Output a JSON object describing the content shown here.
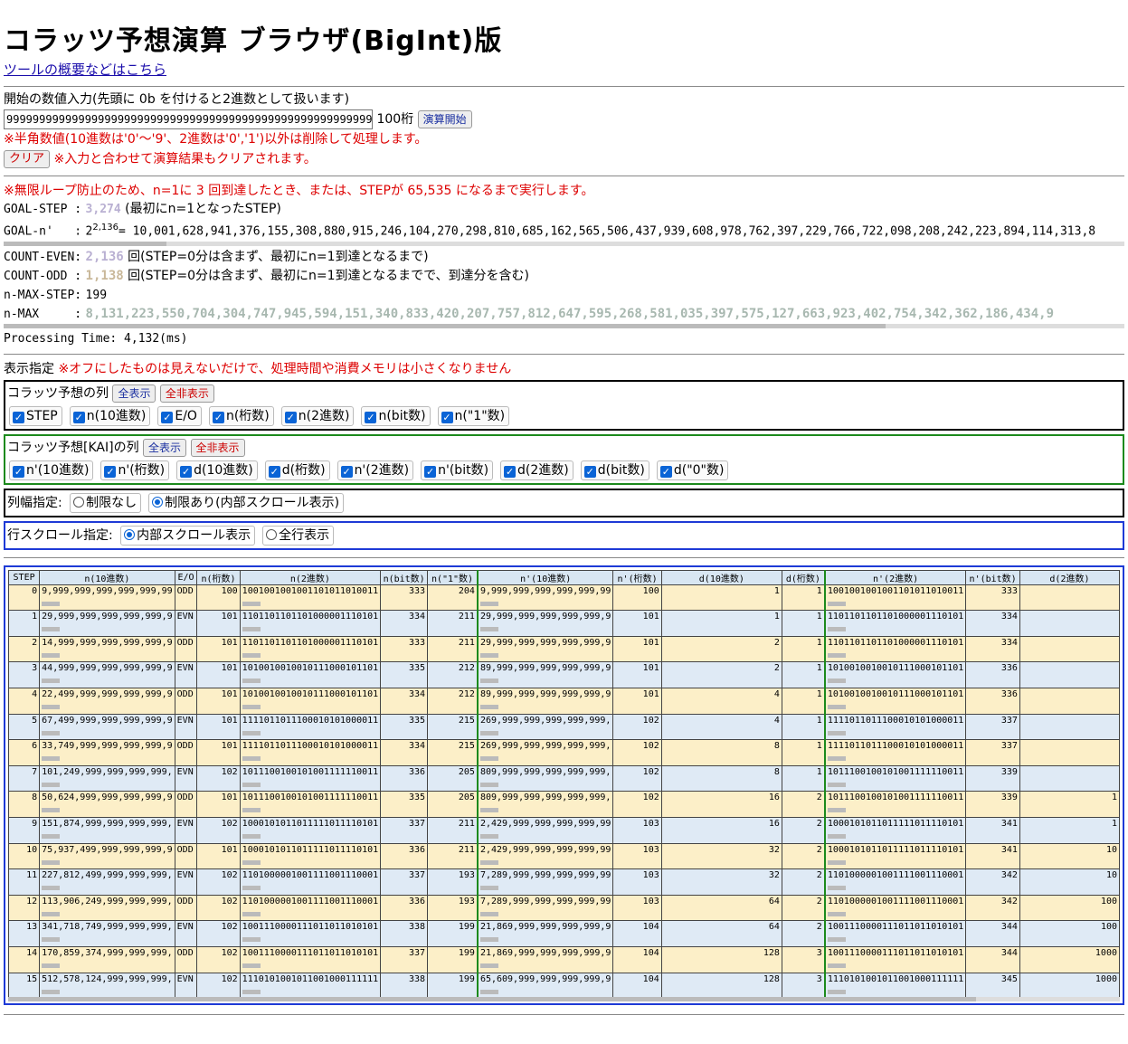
{
  "title": "コラッツ予想演算 ブラウザ(BigInt)版",
  "overview_link": "ツールの概要などはこちら",
  "input": {
    "label": "開始の数値入力(先頭に 0b を付けると2進数として扱います)",
    "value": "9999999999999999999999999999999999999999999999999999999999999999999999999999999999999999999999999999",
    "digits": "100桁",
    "start_button": "演算開始",
    "note": "※半角数値(10進数は'0'～'9'、2進数は'0','1')以外は削除して処理します。",
    "clear_button": "クリア",
    "clear_note": "※入力と合わせて演算結果もクリアされます。"
  },
  "results": {
    "note": "※無限ループ防止のため、n=1に 3 回到達したとき、または、STEPが 65,535 になるまで実行します。",
    "goal_step_label": "GOAL-STEP :",
    "goal_step_value": "3,274",
    "goal_step_note": "(最初にn=1となったSTEP)",
    "goal_n_label": "GOAL-n'   :",
    "goal_n_base": "2",
    "goal_n_exp": "2,136",
    "goal_n_value": "= 10,001,628,941,376,155,308,880,915,246,104,270,298,810,685,162,565,506,437,939,608,978,762,397,229,766,722,098,208,242,223,894,114,313,8",
    "count_even_label": "COUNT-EVEN:",
    "count_even_value": "2,136",
    "count_even_note": "回(STEP=0分は含まず、最初にn=1到達となるまで)",
    "count_odd_label": "COUNT-ODD :",
    "count_odd_value": "1,138",
    "count_odd_note": "回(STEP=0分は含まず、最初にn=1到達となるまでで、到達分を含む)",
    "max_step_label": "n-MAX-STEP:",
    "max_step_value": "199",
    "max_label": "n-MAX     :",
    "max_value": "8,131,223,550,704,304,747,945,594,151,340,833,420,207,757,812,647,595,268,581,035,397,575,127,663,923,402,754,342,362,186,434,9",
    "processing_time": "Processing Time: 4,132(ms)"
  },
  "display": {
    "label": "表示指定",
    "note": "※オフにしたものは見えないだけで、処理時間や消費メモリは小さくなりません",
    "collatz": {
      "title": "コラッツ予想の列",
      "show_all": "全表示",
      "hide_all": "全非表示",
      "checks": [
        "STEP",
        "n(10進数)",
        "E/O",
        "n(桁数)",
        "n(2進数)",
        "n(bit数)",
        "n(\"1\"数)"
      ]
    },
    "kai": {
      "title": "コラッツ予想[KAI]の列",
      "show_all": "全表示",
      "hide_all": "全非表示",
      "checks": [
        "n'(10進数)",
        "n'(桁数)",
        "d(10進数)",
        "d(桁数)",
        "n'(2進数)",
        "n'(bit数)",
        "d(2進数)",
        "d(bit数)",
        "d(\"0\"数)"
      ]
    },
    "width": {
      "label": "列幅指定:",
      "options": [
        "制限なし",
        "制限あり(内部スクロール表示)"
      ],
      "selected": 1
    },
    "scroll": {
      "label": "行スクロール指定:",
      "options": [
        "内部スクロール表示",
        "全行表示"
      ],
      "selected": 0
    }
  },
  "table": {
    "headers": [
      "STEP",
      "n(10進数)",
      "E/O",
      "n(桁数)",
      "n(2進数)",
      "n(bit数)",
      "n(\"1\"数)",
      "n'(10進数)",
      "n'(桁数)",
      "d(10進数)",
      "d(桁数)",
      "n'(2進数)",
      "n'(bit数)",
      "d(2進数)"
    ],
    "rows": [
      [
        "0",
        "9,999,999,999,999,999,99",
        "ODD",
        "100",
        "1001001001001101011010011",
        "333",
        "204",
        "9,999,999,999,999,999,99",
        "100",
        "1",
        "1",
        "1001001001001101011010011",
        "333",
        ""
      ],
      [
        "1",
        "29,999,999,999,999,999,9",
        "EVN",
        "101",
        "1101101101101000001110101",
        "334",
        "211",
        "29,999,999,999,999,999,9",
        "101",
        "1",
        "1",
        "1101101101101000001110101",
        "334",
        ""
      ],
      [
        "2",
        "14,999,999,999,999,999,9",
        "ODD",
        "101",
        "1101101101101000001110101",
        "333",
        "211",
        "29,999,999,999,999,999,9",
        "101",
        "2",
        "1",
        "1101101101101000001110101",
        "334",
        ""
      ],
      [
        "3",
        "44,999,999,999,999,999,9",
        "EVN",
        "101",
        "1010010010010111000101101",
        "335",
        "212",
        "89,999,999,999,999,999,9",
        "101",
        "2",
        "1",
        "1010010010010111000101101",
        "336",
        ""
      ],
      [
        "4",
        "22,499,999,999,999,999,9",
        "ODD",
        "101",
        "1010010010010111000101101",
        "334",
        "212",
        "89,999,999,999,999,999,9",
        "101",
        "4",
        "1",
        "1010010010010111000101101",
        "336",
        ""
      ],
      [
        "5",
        "67,499,999,999,999,999,9",
        "EVN",
        "101",
        "1111011011100010101000011",
        "335",
        "215",
        "269,999,999,999,999,999,",
        "102",
        "4",
        "1",
        "1111011011100010101000011",
        "337",
        ""
      ],
      [
        "6",
        "33,749,999,999,999,999,9",
        "ODD",
        "101",
        "1111011011100010101000011",
        "334",
        "215",
        "269,999,999,999,999,999,",
        "102",
        "8",
        "1",
        "1111011011100010101000011",
        "337",
        ""
      ],
      [
        "7",
        "101,249,999,999,999,999,",
        "EVN",
        "102",
        "1011100100101001111110011",
        "336",
        "205",
        "809,999,999,999,999,999,",
        "102",
        "8",
        "1",
        "1011100100101001111110011",
        "339",
        ""
      ],
      [
        "8",
        "50,624,999,999,999,999,9",
        "ODD",
        "101",
        "1011100100101001111110011",
        "335",
        "205",
        "809,999,999,999,999,999,",
        "102",
        "16",
        "2",
        "1011100100101001111110011",
        "339",
        "1"
      ],
      [
        "9",
        "151,874,999,999,999,999,",
        "EVN",
        "102",
        "1000101011011111011110101",
        "337",
        "211",
        "2,429,999,999,999,999,99",
        "103",
        "16",
        "2",
        "1000101011011111011110101",
        "341",
        "1"
      ],
      [
        "10",
        "75,937,499,999,999,999,9",
        "ODD",
        "101",
        "1000101011011111011110101",
        "336",
        "211",
        "2,429,999,999,999,999,99",
        "103",
        "32",
        "2",
        "1000101011011111011110101",
        "341",
        "10"
      ],
      [
        "11",
        "227,812,499,999,999,999,",
        "EVN",
        "102",
        "1101000001001111001110001",
        "337",
        "193",
        "7,289,999,999,999,999,99",
        "103",
        "32",
        "2",
        "1101000001001111001110001",
        "342",
        "10"
      ],
      [
        "12",
        "113,906,249,999,999,999,",
        "ODD",
        "102",
        "1101000001001111001110001",
        "336",
        "193",
        "7,289,999,999,999,999,99",
        "103",
        "64",
        "2",
        "1101000001001111001110001",
        "342",
        "100"
      ],
      [
        "13",
        "341,718,749,999,999,999,",
        "EVN",
        "102",
        "1001110000111011011010101",
        "338",
        "199",
        "21,869,999,999,999,999,9",
        "104",
        "64",
        "2",
        "1001110000111011011010101",
        "344",
        "100"
      ],
      [
        "14",
        "170,859,374,999,999,999,",
        "ODD",
        "102",
        "1001110000111011011010101",
        "337",
        "199",
        "21,869,999,999,999,999,9",
        "104",
        "128",
        "3",
        "1001110000111011011010101",
        "344",
        "1000"
      ],
      [
        "15",
        "512,578,124,999,999,999,",
        "EVN",
        "102",
        "1110101001011001000111111",
        "338",
        "199",
        "65,609,999,999,999,999,9",
        "104",
        "128",
        "3",
        "1110101001011001000111111",
        "345",
        "1000"
      ]
    ]
  },
  "colors": {
    "odd_row": "#fcefc8",
    "even_row": "#dfeaf5",
    "header": "#d8e6f2",
    "accent_green": "#1c8a1c",
    "accent_blue": "#1e3ad6",
    "warning_red": "#dd0000"
  }
}
